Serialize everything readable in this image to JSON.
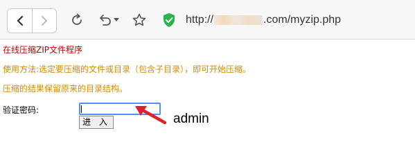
{
  "browser": {
    "url_prefix": "http://",
    "url_suffix": ".com/myzip.php"
  },
  "page": {
    "title": "在线压缩ZIP文件程序",
    "instruction_1": "使用方法:选定要压缩的文件或目录（包含子目录），即可开始压缩。",
    "instruction_2": "压缩的结果保留原来的目录结构。",
    "password_label": "验证密码:",
    "password_value": "",
    "enter_button": "进 入"
  },
  "annotation": {
    "text": "admin"
  },
  "colors": {
    "title": "#c00000",
    "instructions": "#d48b00",
    "arrow": "#e0202e",
    "focus_border": "#4d90fe",
    "secure_shield": "#2bb24c"
  }
}
